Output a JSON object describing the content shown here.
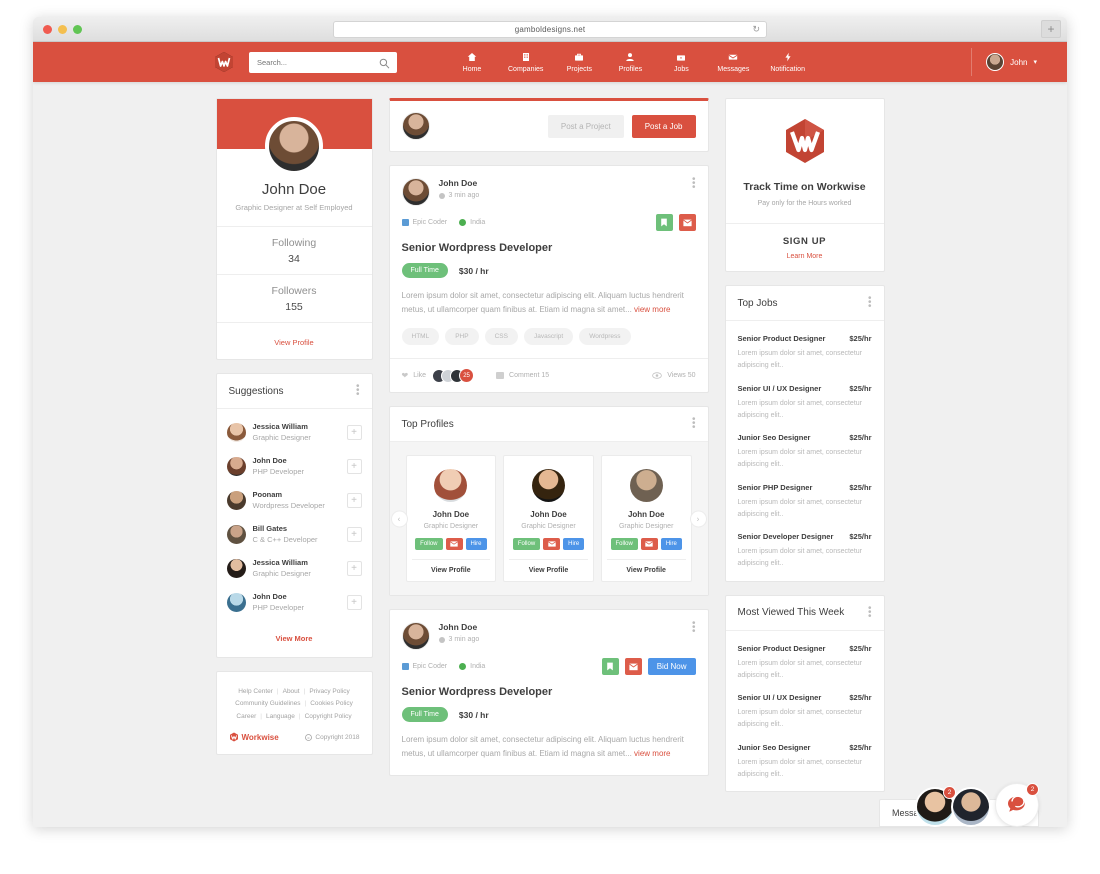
{
  "browser": {
    "url": "gamboldesigns.net",
    "reload_icon": "reload-icon",
    "newtab_label": "+"
  },
  "navbar": {
    "logo": "workwise-logo",
    "search_placeholder": "Search...",
    "search_value": "",
    "links": [
      {
        "label": "Home",
        "icon": "home-icon"
      },
      {
        "label": "Companies",
        "icon": "building-icon"
      },
      {
        "label": "Projects",
        "icon": "briefcase-icon"
      },
      {
        "label": "Profiles",
        "icon": "person-icon"
      },
      {
        "label": "Jobs",
        "icon": "suitcase-icon"
      },
      {
        "label": "Messages",
        "icon": "envelope-icon"
      },
      {
        "label": "Notification",
        "icon": "bolt-icon"
      }
    ],
    "user_name": "John",
    "caret": "▾"
  },
  "profile_card": {
    "name": "John Doe",
    "role": "Graphic Designer at Self Employed",
    "following_label": "Following",
    "following_value": "34",
    "followers_label": "Followers",
    "followers_value": "155",
    "view_profile": "View Profile"
  },
  "suggestions": {
    "title": "Suggestions",
    "items": [
      {
        "name": "Jessica William",
        "role": "Graphic Designer"
      },
      {
        "name": "John Doe",
        "role": "PHP Developer"
      },
      {
        "name": "Poonam",
        "role": "Wordpress Developer"
      },
      {
        "name": "Bill Gates",
        "role": "C & C++ Developer"
      },
      {
        "name": "Jessica William",
        "role": "Graphic Designer"
      },
      {
        "name": "John Doe",
        "role": "PHP Developer"
      }
    ],
    "add_label": "+",
    "view_more": "View More"
  },
  "footer": {
    "links_row1": [
      "Help Center",
      "About",
      "Privacy Policy"
    ],
    "links_row2": [
      "Community Guidelines",
      "Cookies Policy"
    ],
    "links_row3": [
      "Career",
      "Language",
      "Copyright Policy"
    ],
    "brand": "Workwise",
    "copyright": "Copyright 2018"
  },
  "composer": {
    "post_project": "Post a Project",
    "post_job": "Post a Job"
  },
  "posts": [
    {
      "author": "John Doe",
      "time": "3 min ago",
      "company": "Epic Coder",
      "location": "India",
      "title": "Senior Wordpress Developer",
      "type": "Full Time",
      "rate": "$30 / hr",
      "text": "Lorem ipsum dolor sit amet, consectetur adipiscing elit. Aliquam luctus hendrerit metus, ut ullamcorper quam finibus at. Etiam id magna sit amet... ",
      "view_more": "view more",
      "tags": [
        "HTML",
        "PHP",
        "CSS",
        "Javascript",
        "Wordpress"
      ],
      "like_label": "Like",
      "like_count": "25",
      "comment_label": "Comment 15",
      "views_label": "Views 50",
      "has_bid": false,
      "bid_label": ""
    },
    {
      "author": "John Doe",
      "time": "3 min ago",
      "company": "Epic Coder",
      "location": "India",
      "title": "Senior Wordpress Developer",
      "type": "Full Time",
      "rate": "$30 / hr",
      "text": "Lorem ipsum dolor sit amet, consectetur adipiscing elit. Aliquam luctus hendrerit metus, ut ullamcorper quam finibus at. Etiam id magna sit amet... ",
      "view_more": "view more",
      "tags": [],
      "like_label": "",
      "like_count": "",
      "comment_label": "",
      "views_label": "",
      "has_bid": true,
      "bid_label": "Bid Now"
    }
  ],
  "top_profiles": {
    "title": "Top Profiles",
    "items": [
      {
        "name": "John Doe",
        "role": "Graphic Designer",
        "follow": "Follow",
        "hire": "Hire",
        "view": "View Profile"
      },
      {
        "name": "John Doe",
        "role": "Graphic Designer",
        "follow": "Follow",
        "hire": "Hire",
        "view": "View Profile"
      },
      {
        "name": "John Doe",
        "role": "Graphic Designer",
        "follow": "Follow",
        "hire": "Hire",
        "view": "View Profile"
      }
    ],
    "prev": "‹",
    "next": "›"
  },
  "track_widget": {
    "title": "Track Time on Workwise",
    "subtitle": "Pay only for the Hours worked",
    "signup": "SIGN UP",
    "learn_more": "Learn More"
  },
  "top_jobs": {
    "title": "Top Jobs",
    "items": [
      {
        "title": "Senior Product Designer",
        "rate": "$25/hr",
        "desc": "Lorem ipsum dolor sit amet, consectetur adipiscing elit.."
      },
      {
        "title": "Senior UI / UX Designer",
        "rate": "$25/hr",
        "desc": "Lorem ipsum dolor sit amet, consectetur adipiscing elit.."
      },
      {
        "title": "Junior Seo Designer",
        "rate": "$25/hr",
        "desc": "Lorem ipsum dolor sit amet, consectetur adipiscing elit.."
      },
      {
        "title": "Senior PHP Designer",
        "rate": "$25/hr",
        "desc": "Lorem ipsum dolor sit amet, consectetur adipiscing elit.."
      },
      {
        "title": "Senior Developer Designer",
        "rate": "$25/hr",
        "desc": "Lorem ipsum dolor sit amet, consectetur adipiscing elit.."
      }
    ]
  },
  "most_viewed": {
    "title": "Most Viewed This Week",
    "items": [
      {
        "title": "Senior Product Designer",
        "rate": "$25/hr",
        "desc": "Lorem ipsum dolor sit amet, consectetur adipiscing elit.."
      },
      {
        "title": "Senior UI / UX Designer",
        "rate": "$25/hr",
        "desc": "Lorem ipsum dolor sit amet, consectetur adipiscing elit.."
      },
      {
        "title": "Junior Seo Designer",
        "rate": "$25/hr",
        "desc": "Lorem ipsum dolor sit amet, consectetur adipiscing elit.."
      }
    ]
  },
  "chatbar": {
    "strip_label": "Messaged",
    "avatar1_badge": "2",
    "avatar2_badge": "",
    "bubble_badge": "2"
  },
  "colors": {
    "brand": "#d9503f",
    "green": "#6ec07a",
    "blue": "#4d94e8",
    "page_bg": "#f0f0f0"
  }
}
